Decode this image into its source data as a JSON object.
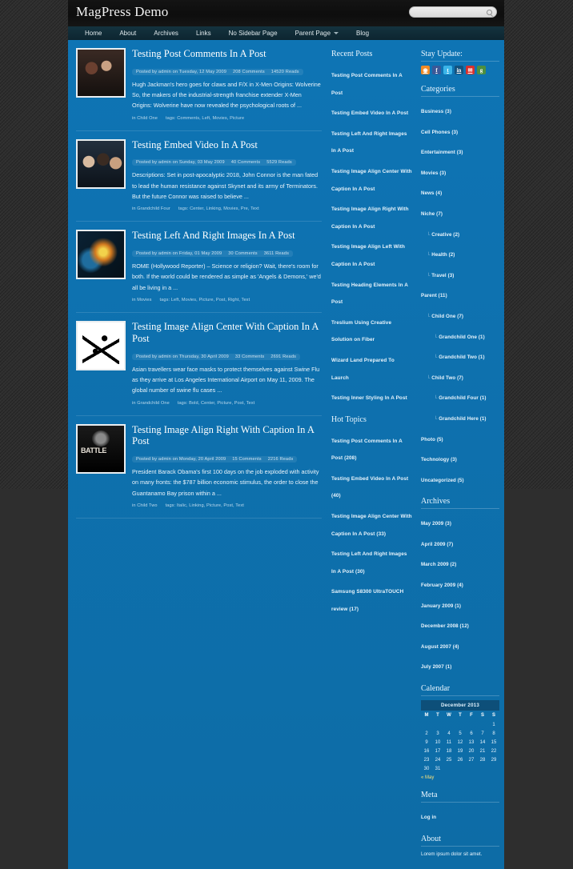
{
  "header": {
    "site_title": "MagPress Demo",
    "search_placeholder": "",
    "search_value": ""
  },
  "nav": {
    "items": [
      {
        "label": "Home",
        "has_caret": false
      },
      {
        "label": "About",
        "has_caret": false
      },
      {
        "label": "Archives",
        "has_caret": false
      },
      {
        "label": "Links",
        "has_caret": false
      },
      {
        "label": "No Sidebar Page",
        "has_caret": false
      },
      {
        "label": "Parent Page",
        "has_caret": true
      },
      {
        "label": "Blog",
        "has_caret": false
      }
    ]
  },
  "posts": [
    {
      "title": "Testing Post Comments In A Post",
      "meta_author": "Posted by admin on Tuesday, 12 May 2009",
      "meta_comments": "208 Comments",
      "meta_reads": "14520 Reads",
      "excerpt": "Hugh Jackman's hero goes for claws and F/X in X-Men Origins: Wolverine So, the makers of the industrial-strength franchise extender X-Men Origins: Wolverine have now revealed the psychological roots of ...",
      "category": "in Child One",
      "tags": "tags: Comments, Left, Movies, Picture",
      "thumb_class": "art1"
    },
    {
      "title": "Testing Embed Video In A Post",
      "meta_author": "Posted by admin on Sunday, 03 May 2009",
      "meta_comments": "40 Comments",
      "meta_reads": "5529 Reads",
      "excerpt": "Descriptions: Set in post-apocalyptic 2018, John Connor is the man fated to lead the human resistance against Skynet and its army of Terminators. But the future Connor was raised to believe ...",
      "category": "in Grandchild Four",
      "tags": "tags: Center, Linking, Movies, Pre, Text",
      "thumb_class": "art2"
    },
    {
      "title": "Testing Left And Right Images In A Post",
      "meta_author": "Posted by admin on Friday, 01 May 2009",
      "meta_comments": "30 Comments",
      "meta_reads": "3611 Reads",
      "excerpt": "ROME (Hollywood Reporter) – Science or religion? Wait, there's room for both. If the world could be rendered as simple as 'Angels & Demons,' we'd all be living in a ...",
      "category": "in Movies",
      "tags": "tags: Left, Movies, Picture, Post, Right, Text",
      "thumb_class": "art3"
    },
    {
      "title": "Testing Image Align Center With Caption In A Post",
      "meta_author": "Posted by admin on Thursday, 30 April 2009",
      "meta_comments": "33 Comments",
      "meta_reads": "2691 Reads",
      "excerpt": "Asian travellers wear face masks to protect themselves against Swine Flu as they arrive at Los Angeles International Airport on May 11, 2009. The global number of swine flu cases ...",
      "category": "in Grandchild One",
      "tags": "tags: Bold, Center, Picture, Post, Text",
      "thumb_class": "art4"
    },
    {
      "title": "Testing Image Align Right With Caption In A Post",
      "meta_author": "Posted by admin on Monday, 20 April 2009",
      "meta_comments": "15 Comments",
      "meta_reads": "2216 Reads",
      "excerpt": "President Barack Obama's first 100 days on the job exploded with activity on many fronts: the $787 billion economic stimulus, the order to close the Guantanamo Bay prison within a ...",
      "category": "in Child Two",
      "tags": "tags: Italic, Linking, Picture, Post, Text",
      "thumb_class": "art5"
    }
  ],
  "recent_posts": {
    "title": "Recent Posts",
    "items": [
      "Testing Post Comments In A Post",
      "Testing Embed Video In A Post",
      "Testing Left And Right Images In A Post",
      "Testing Image Align Center With Caption In A Post",
      "Testing Image Align Right With Caption In A Post",
      "Testing Image Align Left With Caption In A Post",
      "Testing Heading Elements In A Post",
      "Treslium Using Creative Solution on Fiber",
      "Wizard Land Prepared To Laurch",
      "Testing Inner Styling In A Post"
    ]
  },
  "hot_topics": {
    "title": "Hot Topics",
    "items": [
      "Testing Post Comments In A Post (208)",
      "Testing Embed Video In A Post (40)",
      "Testing Image Align Center With Caption In A Post (33)",
      "Testing Left And Right Images In A Post (30)",
      "Samsung S8300 UltraTOUCH review (17)"
    ]
  },
  "stay_update": {
    "title": "Stay Update:",
    "icons": [
      {
        "name": "rss-icon",
        "glyph": "◉",
        "color": "#f08a24"
      },
      {
        "name": "facebook-icon",
        "glyph": "f",
        "color": "#3b5998"
      },
      {
        "name": "twitter-icon",
        "glyph": "t",
        "color": "#3ab4e8"
      },
      {
        "name": "linkedin-icon",
        "glyph": "in",
        "color": "#13527e"
      },
      {
        "name": "delicious-feed-icon",
        "glyph": "✉",
        "color": "#d9302c"
      },
      {
        "name": "google-icon",
        "glyph": "g",
        "color": "#4d8f3f"
      }
    ]
  },
  "categories": {
    "title": "Categories",
    "items": [
      {
        "label": "Business (3)",
        "level": 0
      },
      {
        "label": "Cell Phones (3)",
        "level": 0
      },
      {
        "label": "Entertainment (3)",
        "level": 0
      },
      {
        "label": "Movies (3)",
        "level": 0
      },
      {
        "label": "News (4)",
        "level": 0
      },
      {
        "label": "Niche (7)",
        "level": 0
      },
      {
        "label": "Creative (2)",
        "level": 1
      },
      {
        "label": "Health (2)",
        "level": 1
      },
      {
        "label": "Travel (3)",
        "level": 1
      },
      {
        "label": "Parent (11)",
        "level": 0
      },
      {
        "label": "Child One (7)",
        "level": 1
      },
      {
        "label": "Grandchild One (1)",
        "level": 2
      },
      {
        "label": "Grandchild Two (1)",
        "level": 2
      },
      {
        "label": "Child Two (7)",
        "level": 1
      },
      {
        "label": "Grandchild Four (1)",
        "level": 2
      },
      {
        "label": "Grandchild Here (1)",
        "level": 2
      },
      {
        "label": "Photo (5)",
        "level": 0
      },
      {
        "label": "Technology (3)",
        "level": 0
      },
      {
        "label": "Uncategorized (5)",
        "level": 0
      }
    ]
  },
  "archives": {
    "title": "Archives",
    "items": [
      "May 2009 (3)",
      "April 2009 (7)",
      "March 2009 (2)",
      "February 2009 (4)",
      "January 2009 (1)",
      "December 2008 (12)",
      "August 2007 (4)",
      "July 2007 (1)"
    ]
  },
  "calendar": {
    "title": "Calendar",
    "month_label": "December 2013",
    "weekdays": [
      "M",
      "T",
      "W",
      "T",
      "F",
      "S",
      "S"
    ],
    "weeks": [
      [
        "",
        "",
        "",
        "",
        "",
        "",
        "1"
      ],
      [
        "2",
        "3",
        "4",
        "5",
        "6",
        "7",
        "8"
      ],
      [
        "9",
        "10",
        "11",
        "12",
        "13",
        "14",
        "15"
      ],
      [
        "16",
        "17",
        "18",
        "19",
        "20",
        "21",
        "22"
      ],
      [
        "23",
        "24",
        "25",
        "26",
        "27",
        "28",
        "29"
      ],
      [
        "30",
        "31",
        "",
        "",
        "",
        "",
        ""
      ]
    ],
    "prev_link": "« May"
  },
  "meta": {
    "title": "Meta",
    "items": [
      "Log in"
    ]
  },
  "about": {
    "title": "About",
    "text": "Lorem ipsum dolor sit amet."
  },
  "colors": {
    "page_background": "#2f2f2f",
    "header_background": "#0d0d0d",
    "nav_background": "#14333f",
    "nav_underline": "#0e75b5",
    "content_background": "#0e74b4",
    "text_light": "#e9f4fc"
  }
}
